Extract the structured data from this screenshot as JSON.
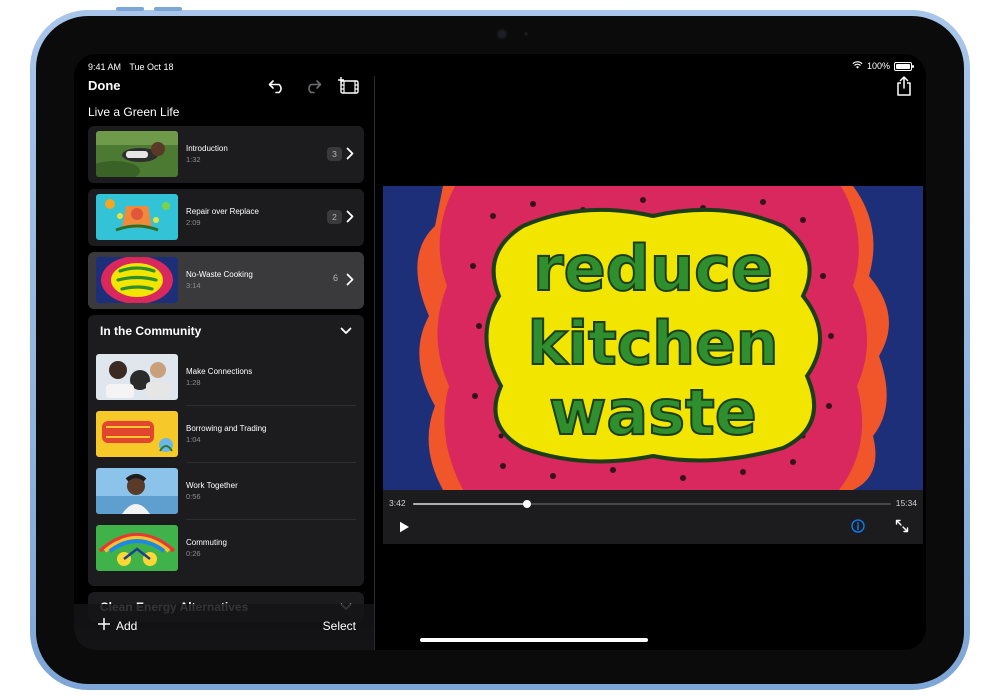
{
  "status": {
    "time": "9:41 AM",
    "date": "Tue Oct 18",
    "battery": "100%",
    "battery_level": 1.0
  },
  "toolbar": {
    "done_label": "Done"
  },
  "project": {
    "title": "Live a Green Life"
  },
  "chapters": [
    {
      "title": "Introduction",
      "duration": "1:32",
      "count": "3"
    },
    {
      "title": "Repair over Replace",
      "duration": "2:09",
      "count": "2"
    },
    {
      "title": "No-Waste Cooking",
      "duration": "3:14",
      "count": "6"
    }
  ],
  "group_community": {
    "title": "In the Community",
    "items": [
      {
        "title": "Make Connections",
        "duration": "1:28"
      },
      {
        "title": "Borrowing and Trading",
        "duration": "1:04"
      },
      {
        "title": "Work Together",
        "duration": "0:56"
      },
      {
        "title": "Commuting",
        "duration": "0:26"
      }
    ]
  },
  "group_energy": {
    "title": "Clean Energy Alternatives"
  },
  "bottom": {
    "add_label": "Add",
    "select_label": "Select"
  },
  "player": {
    "current_time": "3:42",
    "total_time": "15:34",
    "progress": 0.238
  },
  "video_text": {
    "line1": "reduce",
    "line2": "kitchen",
    "line3": "waste"
  },
  "colors": {
    "accent": "#0a84ff",
    "device_frame": "#8fb2de",
    "text_green": "#2f8f2f",
    "blob_yellow": "#f2e500"
  }
}
